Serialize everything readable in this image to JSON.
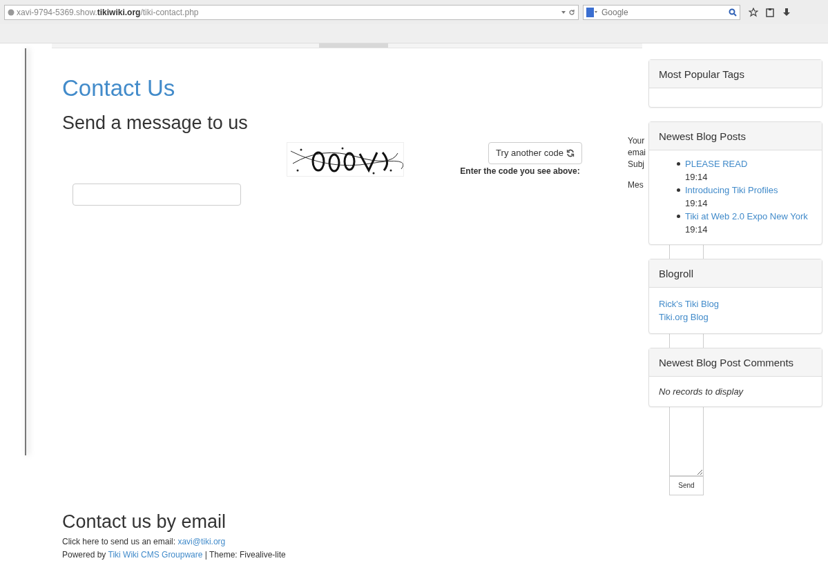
{
  "browser": {
    "url_host": "xavi-9794-5369.show.",
    "url_domain": "tikiwiki.org",
    "url_path": "/tiki-contact.php",
    "search_placeholder": "Google"
  },
  "page": {
    "title": "Contact Us",
    "form_heading": "Send a message to us",
    "captcha": {
      "kind": "picture",
      "refresh_button": "Try another code",
      "instruction": "Enter the code you see above:"
    },
    "clipped_labels": [
      "Your",
      "emai",
      "Subj",
      "Mes"
    ],
    "send_button": "Send"
  },
  "footer": {
    "heading": "Contact us by email",
    "email_prefix": "Click here to send us an email: ",
    "email": "xavi@tiki.org",
    "powered_prefix": "Powered by ",
    "powered_link": "Tiki Wiki CMS Groupware",
    "theme": " | Theme: Fivealive-lite"
  },
  "sidebar": [
    {
      "title": "Most Popular Tags",
      "kind": "empty"
    },
    {
      "title": "Newest Blog Posts",
      "kind": "posts",
      "posts": [
        {
          "title": "PLEASE READ",
          "time": "19:14"
        },
        {
          "title": "Introducing Tiki Profiles",
          "time": "19:14"
        },
        {
          "title": "Tiki at Web 2.0 Expo New York",
          "time": "19:14"
        }
      ]
    },
    {
      "title": "Blogroll",
      "kind": "links",
      "links": [
        "Rick's Tiki Blog",
        "Tiki.org Blog"
      ]
    },
    {
      "title": "Newest Blog Post Comments",
      "kind": "note",
      "note": "No records to display"
    }
  ]
}
